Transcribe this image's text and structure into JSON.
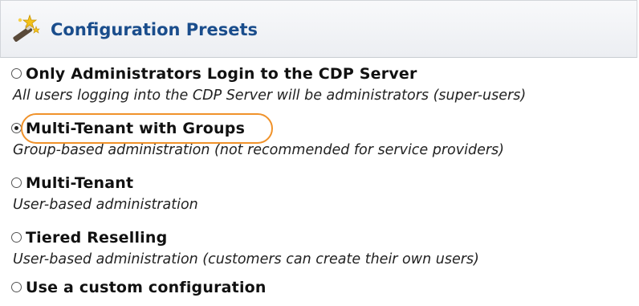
{
  "header": {
    "title": "Configuration Presets",
    "icon": "wand-icon"
  },
  "options": [
    {
      "label": "Only Administrators Login to the CDP Server",
      "description": "All users logging into the CDP Server will be administrators (super-users)",
      "selected": false
    },
    {
      "label": "Multi-Tenant with Groups",
      "description": "Group-based administration (not recommended for service providers)",
      "selected": true
    },
    {
      "label": "Multi-Tenant",
      "description": "User-based administration",
      "selected": false
    },
    {
      "label": "Tiered Reselling",
      "description": "User-based administration (customers can create their own users)",
      "selected": false
    },
    {
      "label": "Use a custom configuration",
      "description": "",
      "selected": false
    }
  ],
  "colors": {
    "title": "#1a4d8c",
    "highlight": "#f0922a"
  }
}
